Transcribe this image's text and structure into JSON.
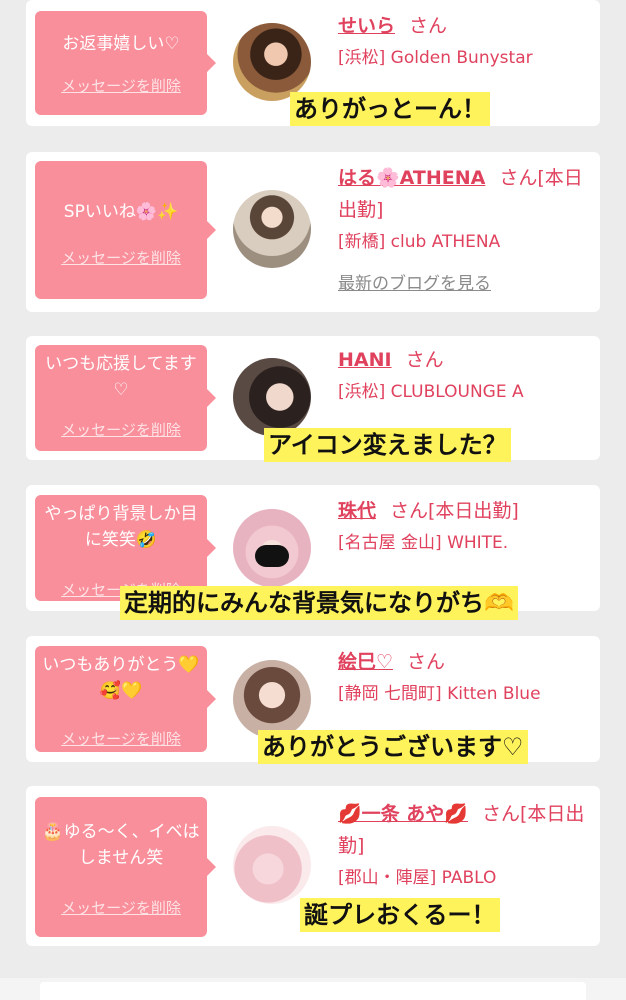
{
  "colors": {
    "bubble": "#f98f9b",
    "name": "#e0425e",
    "caption_bg": "#fff35c",
    "background": "#ececec"
  },
  "delete_label": "メッセージを削除",
  "blog_label": "最新のブログを見る",
  "cards": [
    {
      "message": "お返事嬉しい♡",
      "name": "せいら",
      "suffix": "さん",
      "shop": "[浜松] Golden Bunystar",
      "caption": "ありがっとーん！"
    },
    {
      "message": "SPいいね🌸✨",
      "name": "はる🌸ATHENA",
      "suffix": "さん[本日出勤]",
      "shop": "[新橋] club ATHENA",
      "caption": ""
    },
    {
      "message": "いつも応援してます♡",
      "name": "HANI",
      "suffix": "さん",
      "shop": "[浜松] CLUBLOUNGE A",
      "caption": "アイコン変えました？"
    },
    {
      "message": "やっぱり背景しか目に笑笑🤣",
      "name": "珠代",
      "suffix": "さん[本日出勤]",
      "shop": "[名古屋 金山] WHITE.",
      "caption": "定期的にみんな背景気になりがち🫶"
    },
    {
      "message": "いつもありがとう💛🥰💛",
      "name": "絵巳♡",
      "suffix": "さん",
      "shop": "[静岡 七間町] Kitten Blue",
      "caption": "ありがとうございます♡"
    },
    {
      "message": "🎂ゆる〜く、イベはしません笑",
      "name": "💋一条 あや💋",
      "suffix": "さん[本日出勤]",
      "shop": "[郡山・陣屋] PABLO",
      "caption": "誕プレおくるー！"
    }
  ]
}
